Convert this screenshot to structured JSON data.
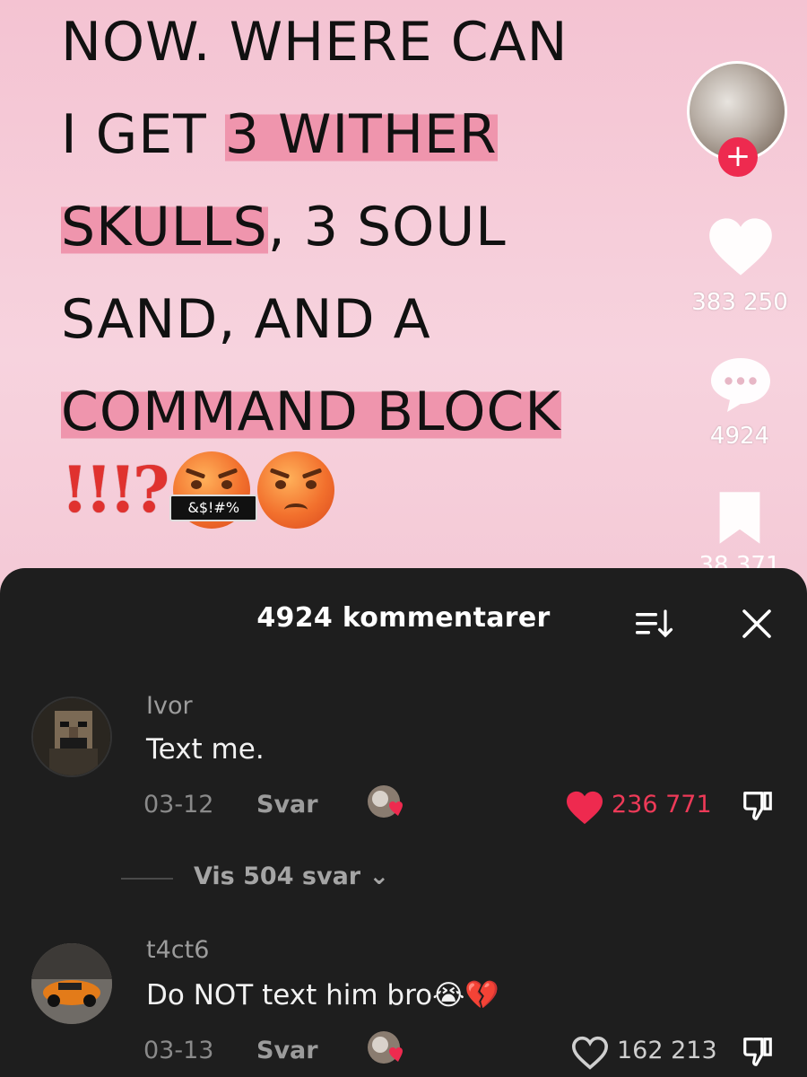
{
  "video": {
    "caption_lines": [
      {
        "pre": "NOW. WHERE CAN",
        "hl": "",
        "post": ""
      },
      {
        "pre": "I GET ",
        "hl": "3 WITHER",
        "post": ""
      },
      {
        "pre": "",
        "hl": "SKULLS",
        "post": ", 3 SOUL"
      },
      {
        "pre": "SAND, AND A",
        "hl": "",
        "post": ""
      },
      {
        "pre": "",
        "hl": "COMMAND BLOCK",
        "post": ""
      }
    ],
    "exclaim": "!!!?",
    "censor_text": "&$!#%"
  },
  "rail": {
    "like_count": "383 250",
    "comment_count": "4924",
    "save_count": "38 371",
    "follow_symbol": "+"
  },
  "sheet": {
    "title": "4924 kommentarer",
    "close_symbol": "✕"
  },
  "comments": [
    {
      "user": "Ivor",
      "text": "Text me.",
      "date": "03-12",
      "reply_label": "Svar",
      "likes": "236 771",
      "liked": true,
      "view_replies": "Vis 504 svar ⌄"
    },
    {
      "user": "t4ct6",
      "text": "Do NOT text him bro😭💔",
      "date": "03-13",
      "reply_label": "Svar",
      "likes": "162 213",
      "liked": false
    }
  ],
  "colors": {
    "accent_red": "#ee2a4f",
    "sheet_bg": "#1e1e1e",
    "highlight_pink": "#ef95ad"
  },
  "icons": [
    "heart-icon",
    "comment-bubble-icon",
    "bookmark-icon",
    "sort-icon",
    "close-icon",
    "thumbs-down-icon"
  ]
}
